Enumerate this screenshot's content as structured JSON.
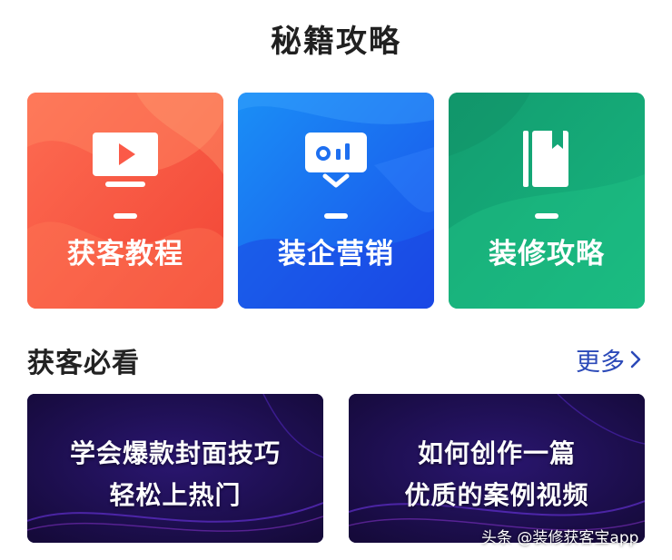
{
  "header": {
    "title": "秘籍攻略"
  },
  "tips": [
    {
      "label": "获客教程",
      "icon": "monitor-play-icon",
      "color": "#fb5a48"
    },
    {
      "label": "装企营销",
      "icon": "presentation-chart-icon",
      "color": "#1e6ff0"
    },
    {
      "label": "装修攻略",
      "icon": "book-bookmark-icon",
      "color": "#14a777"
    }
  ],
  "section": {
    "title": "获客必看",
    "more_label": "更多"
  },
  "videos": [
    {
      "line1": "学会爆款封面技巧",
      "line2": "轻松上热门"
    },
    {
      "line1": "如何创作一篇",
      "line2": "优质的案例视频"
    }
  ],
  "watermark": "头条 @装修获客宝app",
  "colors": {
    "accent_link": "#2b49b8",
    "video_bg": "#1c0f4e"
  }
}
